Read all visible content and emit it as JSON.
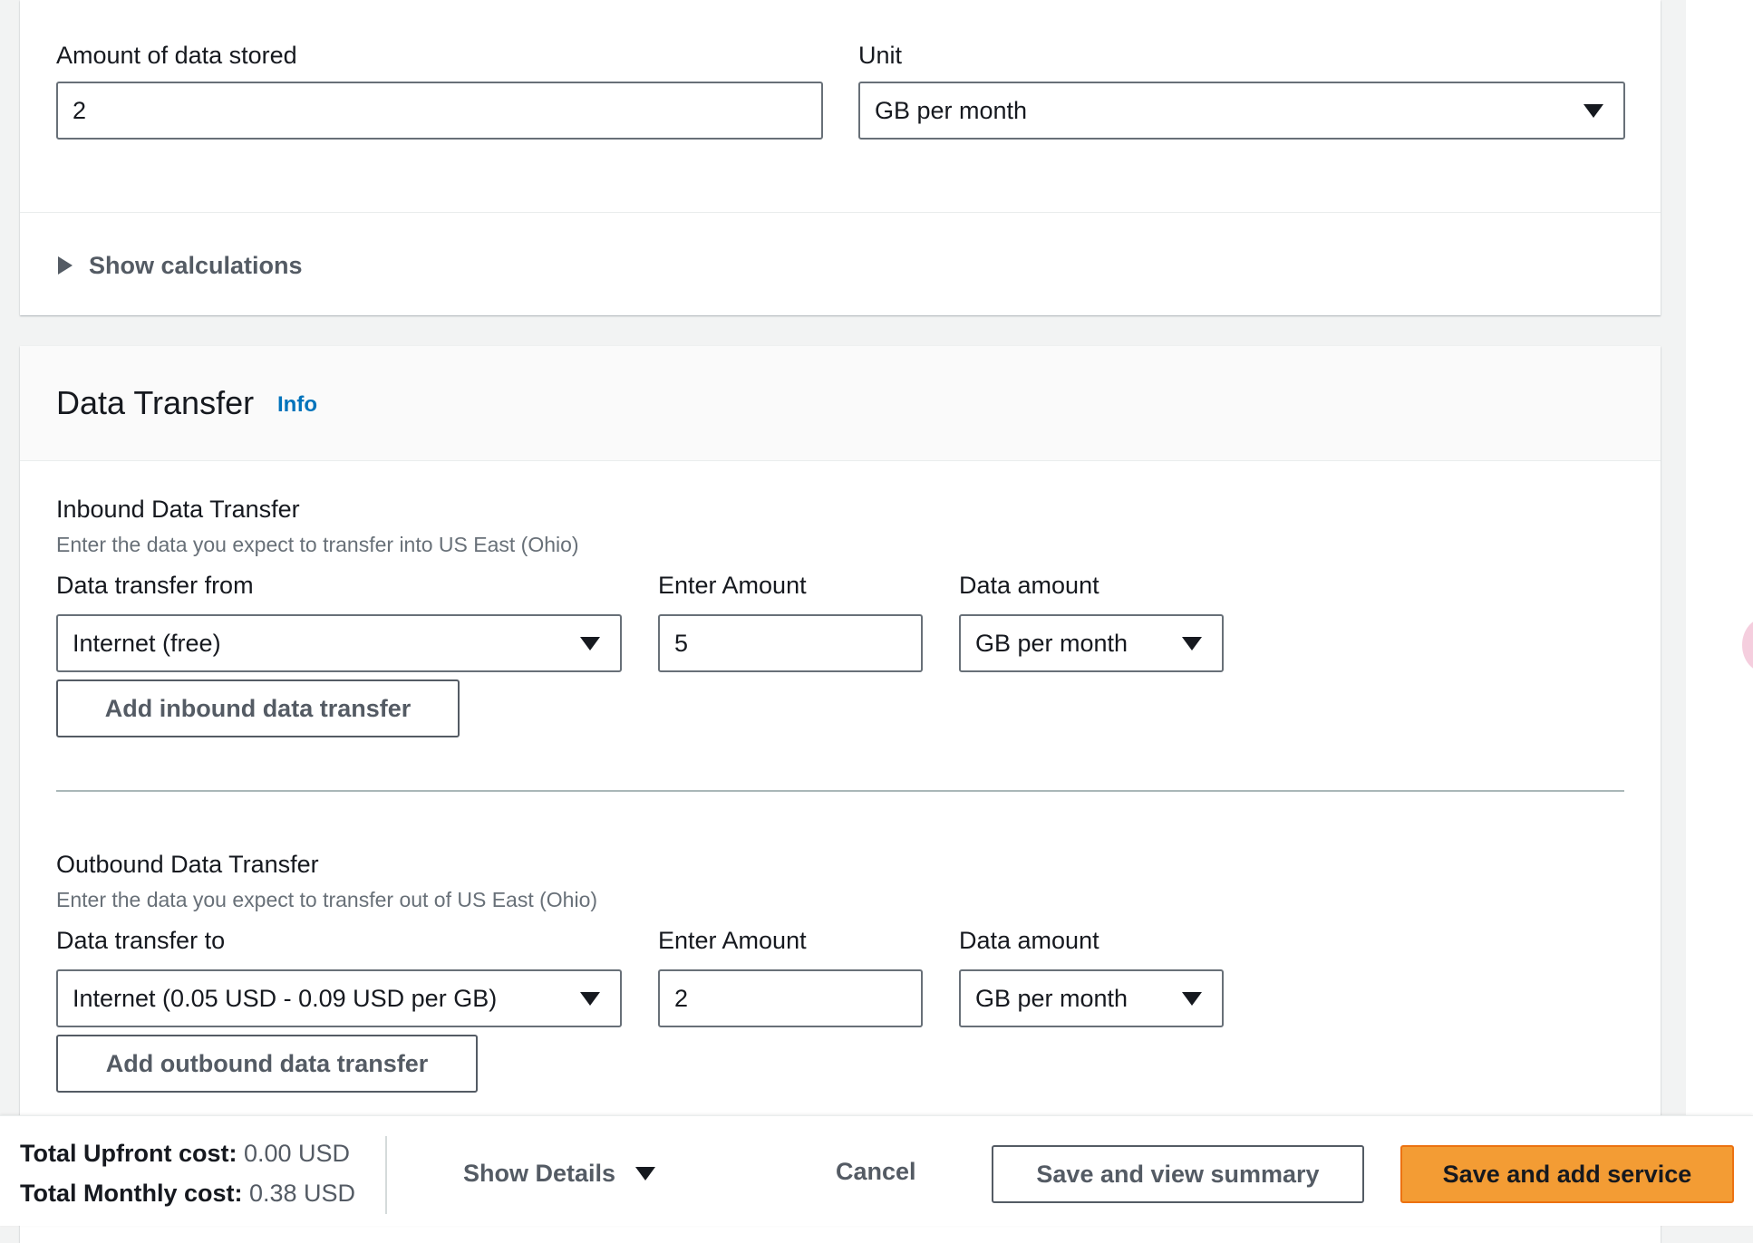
{
  "storage": {
    "amount_label": "Amount of data stored",
    "amount_value": "2",
    "unit_label": "Unit",
    "unit_value": "GB per month",
    "show_calculations": "Show calculations"
  },
  "data_transfer": {
    "title": "Data Transfer",
    "info_link": "Info",
    "inbound": {
      "heading": "Inbound Data Transfer",
      "description": "Enter the data you expect to transfer into US East (Ohio)",
      "from_label": "Data transfer from",
      "from_value": "Internet (free)",
      "amount_label": "Enter Amount",
      "amount_value": "5",
      "unit_label": "Data amount",
      "unit_value": "GB per month",
      "add_button": "Add inbound data transfer"
    },
    "outbound": {
      "heading": "Outbound Data Transfer",
      "description": "Enter the data you expect to transfer out of US East (Ohio)",
      "to_label": "Data transfer to",
      "to_value": "Internet (0.05 USD - 0.09 USD per GB)",
      "amount_label": "Enter Amount",
      "amount_value": "2",
      "unit_label": "Data amount",
      "unit_value": "GB per month",
      "add_button": "Add outbound data transfer"
    }
  },
  "footer": {
    "upfront_label": "Total Upfront cost:",
    "upfront_value": "0.00 USD",
    "monthly_label": "Total Monthly cost:",
    "monthly_value": "0.38 USD",
    "show_details": "Show Details",
    "cancel": "Cancel",
    "save_view_summary": "Save and view summary",
    "save_add_service": "Save and add service"
  },
  "colors": {
    "primary_button": "#f39c34",
    "info_link": "#0073bb",
    "page_background": "#f2f3f3"
  }
}
